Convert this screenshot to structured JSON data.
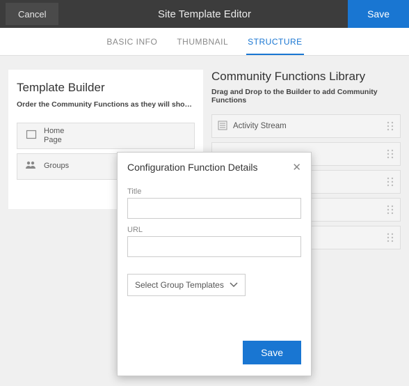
{
  "topbar": {
    "cancel": "Cancel",
    "title": "Site Template Editor",
    "save": "Save"
  },
  "tabs": {
    "basic": "BASIC INFO",
    "thumbnail": "THUMBNAIL",
    "structure": "STRUCTURE"
  },
  "builder": {
    "title": "Template Builder",
    "subtitle": "Order the Community Functions as they will show in the …",
    "items": [
      {
        "label": "Home\nPage",
        "icon": "page"
      },
      {
        "label": "Groups",
        "icon": "groups"
      }
    ]
  },
  "library": {
    "title": "Community Functions Library",
    "subtitle": "Drag and Drop to the Builder to add Community Functions",
    "items": [
      {
        "label": "Activity Stream"
      },
      {
        "label": ""
      },
      {
        "label": ""
      },
      {
        "label": ""
      },
      {
        "label": ""
      }
    ]
  },
  "modal": {
    "title": "Configuration Function Details",
    "field_title": "Title",
    "field_url": "URL",
    "select_placeholder": "Select Group Templates",
    "save": "Save"
  }
}
